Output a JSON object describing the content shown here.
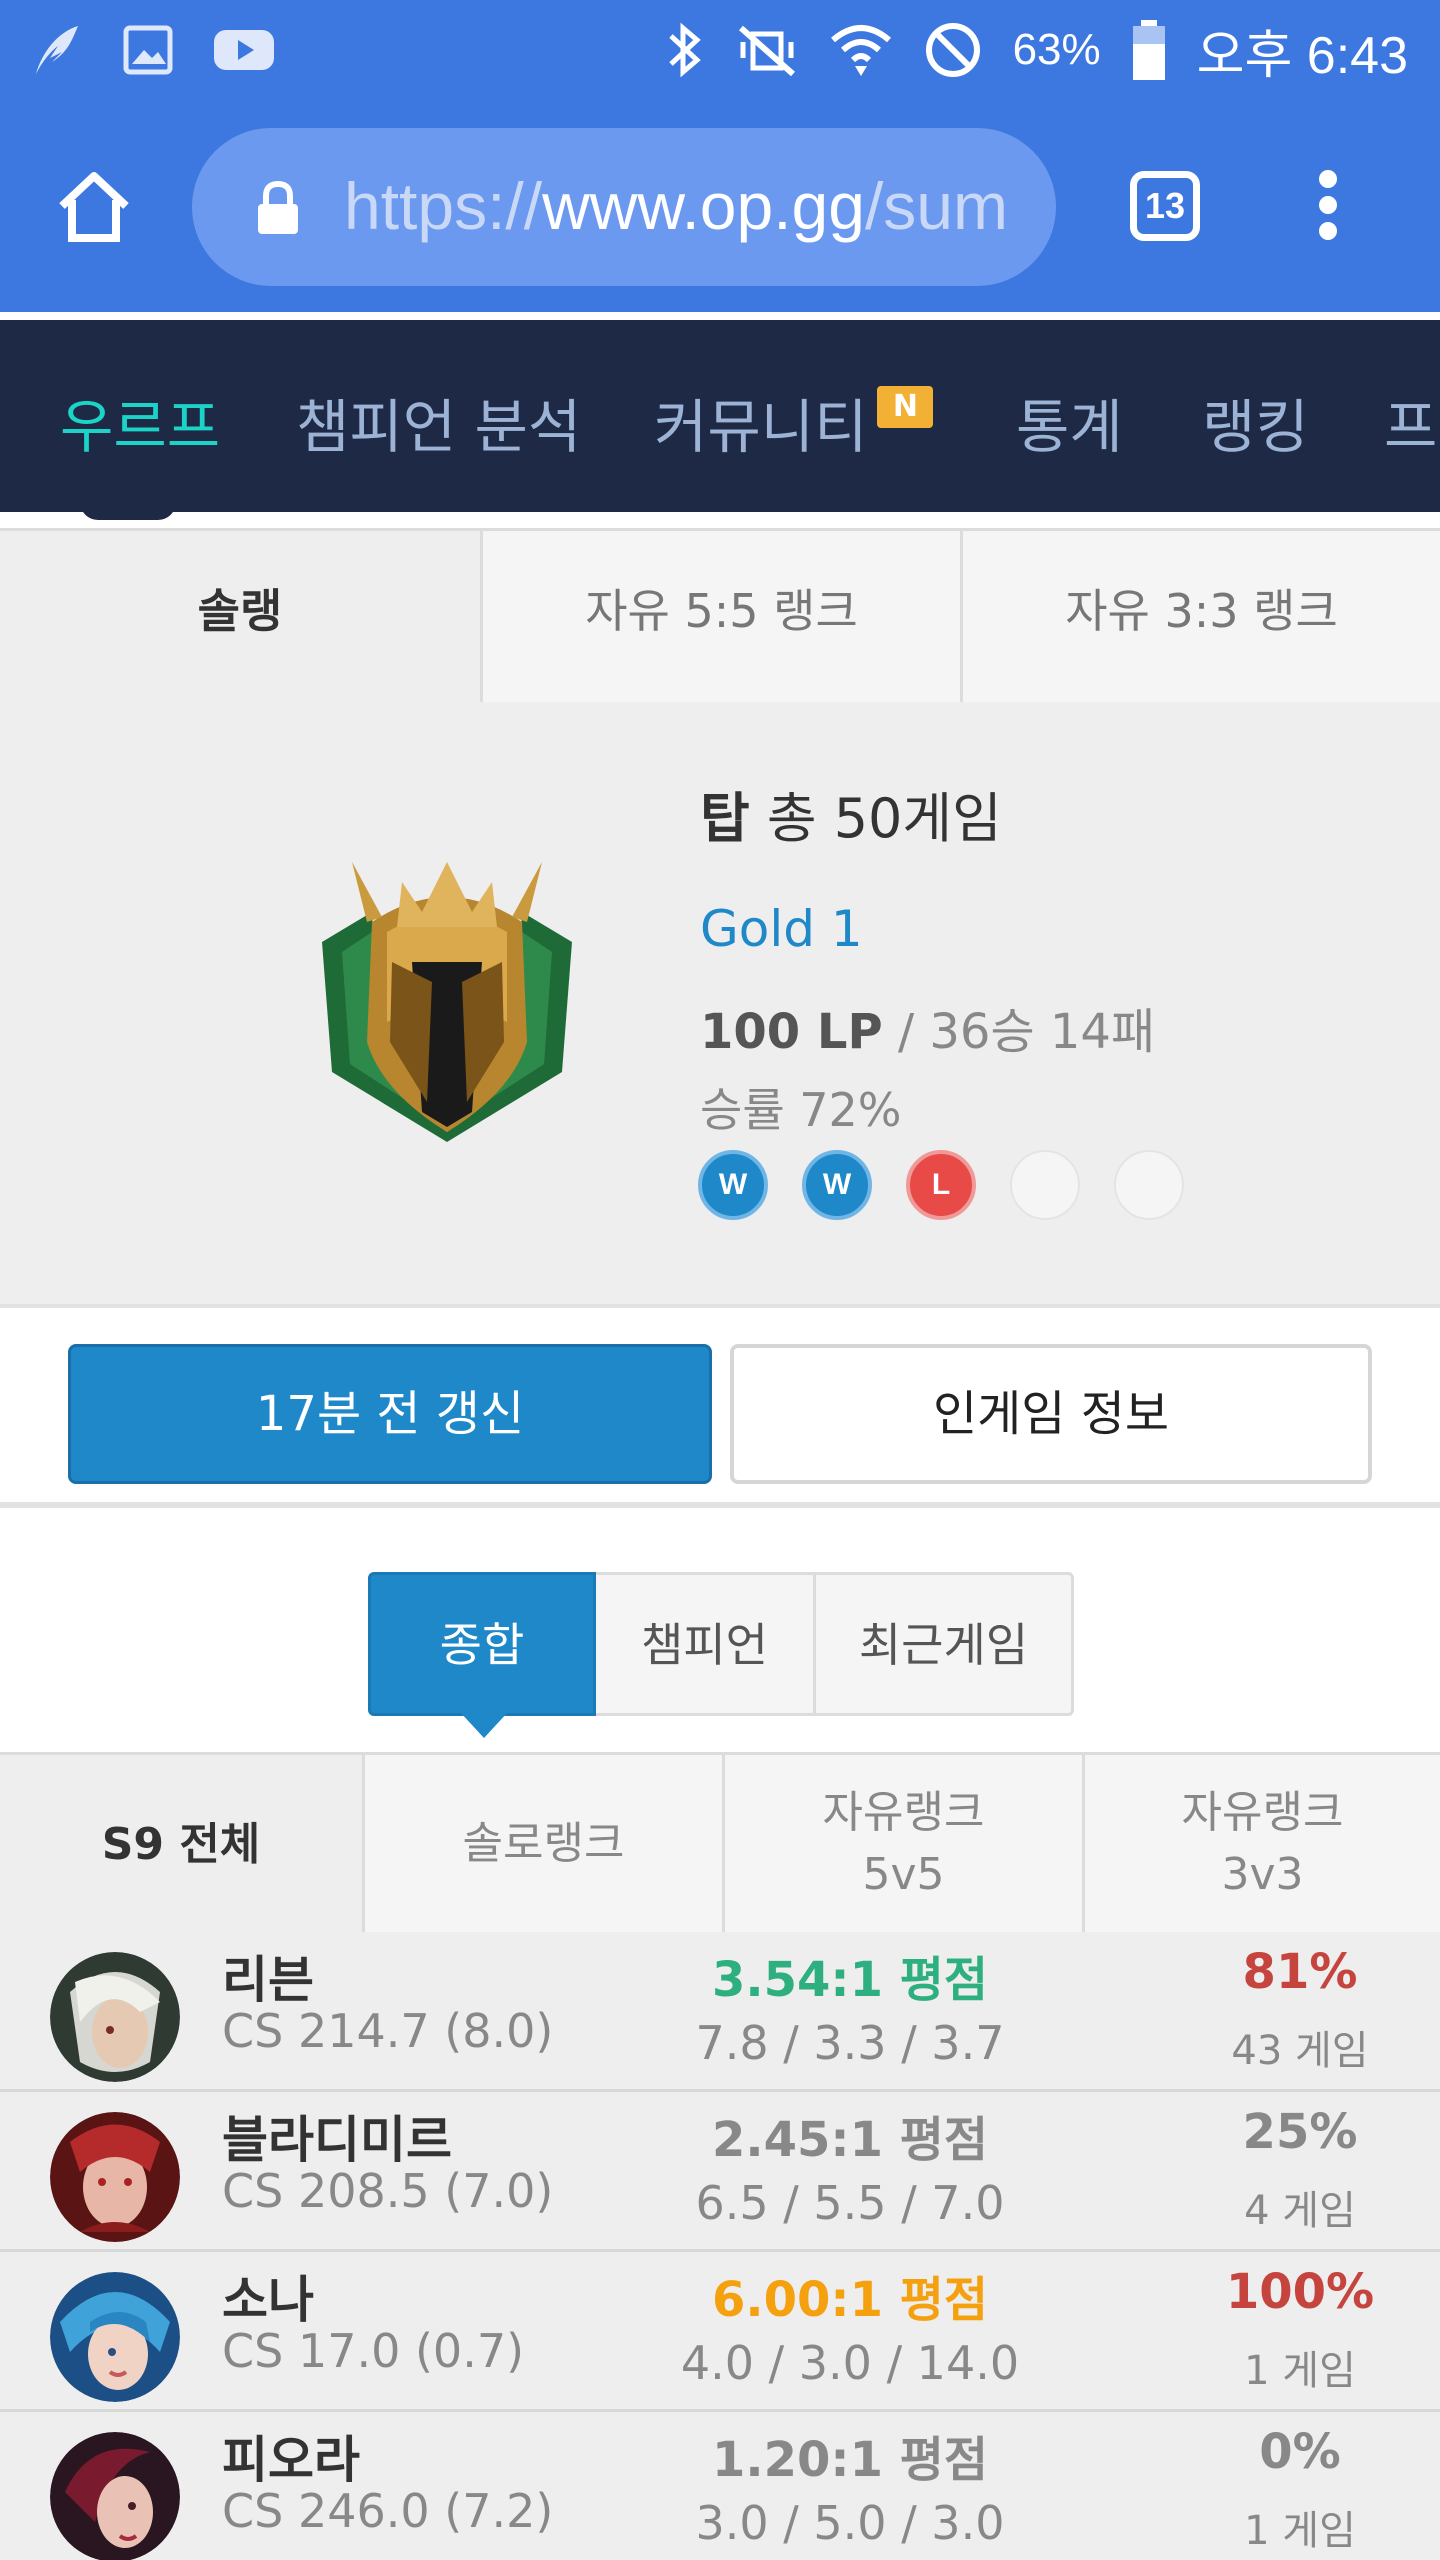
{
  "status_bar": {
    "battery": "63%",
    "time": "오후 6:43"
  },
  "browser": {
    "url_scheme": "https://",
    "url_host": "www.op.gg",
    "url_rest": "/sum",
    "tab_count": "13"
  },
  "site_nav": {
    "items": [
      "우르프",
      "챔피언 분석",
      "커뮤니티",
      "통계",
      "랭킹",
      "프"
    ],
    "community_badge": "N"
  },
  "queue_tabs": [
    "솔랭",
    "자유 5:5 랭크",
    "자유 3:3 랭크"
  ],
  "rank": {
    "position": "탑",
    "games_label": "총 50게임",
    "tier": "Gold 1",
    "lp": "100 LP",
    "record": "/ 36승 14패",
    "winrate": "승률 72%",
    "streak": [
      "W",
      "W",
      "L",
      "",
      ""
    ]
  },
  "actions": {
    "refresh_label": "17분 전 갱신",
    "ingame_label": "인게임 정보"
  },
  "view_tabs": [
    "종합",
    "챔피언",
    "최근게임"
  ],
  "season_tabs": {
    "all": "S9 전체",
    "solo": "솔로랭크",
    "flex5_line1": "자유랭크",
    "flex5_line2": "5v5",
    "flex3_line1": "자유랭크",
    "flex3_line2": "3v3"
  },
  "colors": {
    "brand_blue": "#1e88c9",
    "kda_green": "#2daf7f",
    "kda_orange": "#f5a00e",
    "winrate_red": "#c6443e",
    "muted": "#888888"
  },
  "champions": [
    {
      "name": "리븐",
      "cs": "CS 214.7 (8.0)",
      "kda_ratio": "3.54:1 평점",
      "kda": "7.8 / 3.3 / 3.7",
      "winrate": "81%",
      "games": "43 게임"
    },
    {
      "name": "블라디미르",
      "cs": "CS 208.5 (7.0)",
      "kda_ratio": "2.45:1 평점",
      "kda": "6.5 / 5.5 / 7.0",
      "winrate": "25%",
      "games": "4 게임"
    },
    {
      "name": "소나",
      "cs": "CS 17.0 (0.7)",
      "kda_ratio": "6.00:1 평점",
      "kda": "4.0 / 3.0 / 14.0",
      "winrate": "100%",
      "games": "1 게임"
    },
    {
      "name": "피오라",
      "cs": "CS 246.0 (7.2)",
      "kda_ratio": "1.20:1 평점",
      "kda": "3.0 / 5.0 / 3.0",
      "winrate": "0%",
      "games": "1 게임"
    }
  ]
}
